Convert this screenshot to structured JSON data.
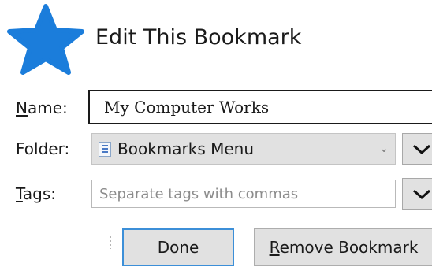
{
  "dialog": {
    "title": "Edit This Bookmark",
    "icon": "star-icon",
    "accent_color": "#1b7ddb"
  },
  "name": {
    "label_accesskey": "N",
    "label_rest": "ame:",
    "value": "My Computer Works"
  },
  "folder": {
    "label": "Folder:",
    "value": "Bookmarks Menu",
    "icon": "bookmarks-folder-icon"
  },
  "tags": {
    "label_accesskey": "T",
    "label_rest": "ags:",
    "value": "",
    "placeholder": "Separate tags with commas"
  },
  "buttons": {
    "done": "Done",
    "remove_accesskey": "R",
    "remove_rest": "emove Bookmark",
    "done_border_color": "#3c8fd8"
  }
}
